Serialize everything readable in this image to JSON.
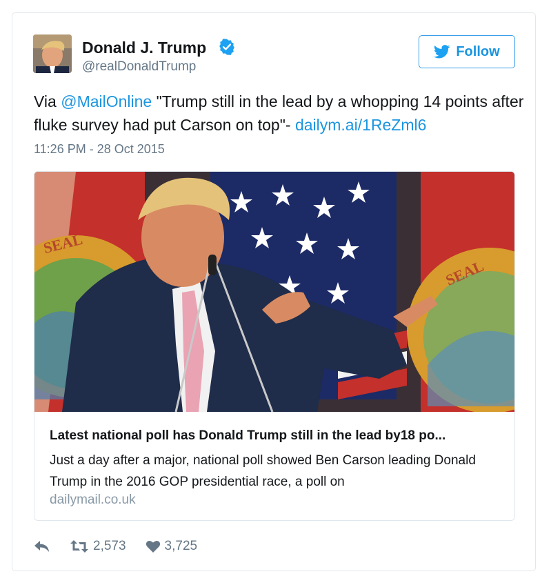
{
  "author": {
    "name": "Donald J. Trump",
    "handle": "@realDonaldTrump"
  },
  "follow_button": {
    "label": "Follow"
  },
  "tweet": {
    "text_prefix": "Via ",
    "mention": "@MailOnline",
    "text_body": " \"Trump still in the lead by a whopping 14 points after fluke survey had put Carson on top\"- ",
    "link": "dailym.ai/1ReZml6",
    "timestamp": "11:26 PM - 28 Oct 2015"
  },
  "link_card": {
    "title": "Latest national poll has Donald Trump still in the lead by18 po...",
    "description": "Just a day after a major, national poll showed Ben Carson leading Donald Trump in the 2016 GOP presidential race, a poll on",
    "domain": "dailymail.co.uk",
    "seal_text_left": "SEAL",
    "seal_text_right": "SEAL"
  },
  "actions": {
    "retweets": "2,573",
    "likes": "3,725"
  },
  "colors": {
    "link_blue": "#1b95e0",
    "muted_gray": "#657786",
    "border": "#e1e8ed"
  },
  "icons": [
    "verified-badge-icon",
    "twitter-bird-icon",
    "reply-icon",
    "retweet-icon",
    "heart-icon"
  ]
}
